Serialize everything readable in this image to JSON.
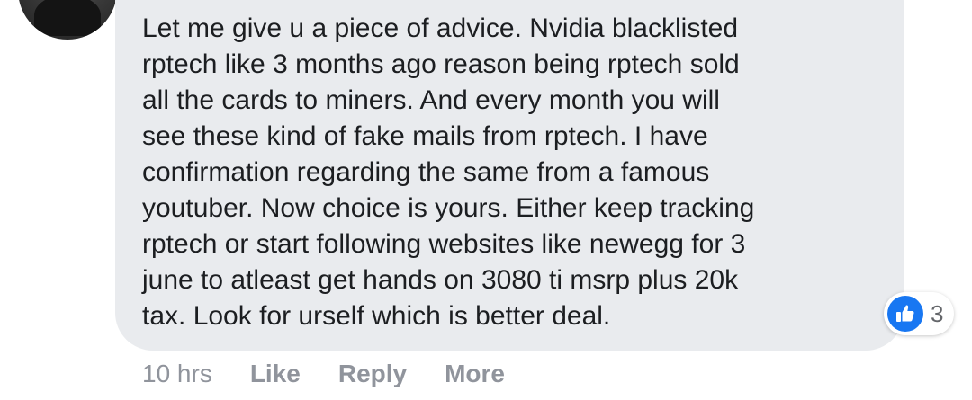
{
  "comment": {
    "text": "Let me give u a piece of advice. Nvidia blacklisted\nrptech like 3 months ago reason being rptech sold\nall the cards to miners. And every month you will\nsee these kind of fake mails from rptech. I have\nconfirmation regarding the same from a famous\nyoutuber. Now choice is yours. Either keep tracking\nrptech or start following websites like newegg for 3\njune to atleast get hands on 3080 ti msrp plus 20k\ntax. Look for urself which is better deal."
  },
  "reactions": {
    "icon": "like-icon",
    "count": "3",
    "color": "#1877f2"
  },
  "actions": {
    "timestamp": "10 hrs",
    "like_label": "Like",
    "reply_label": "Reply",
    "more_label": "More"
  }
}
